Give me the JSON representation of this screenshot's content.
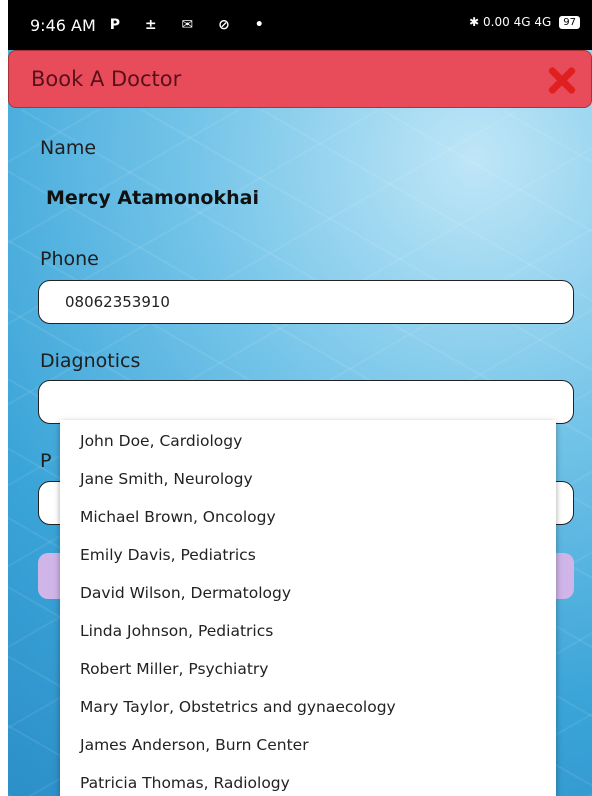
{
  "status_bar": {
    "time": "9:46 AM",
    "left_icons": "P ± ✉ ⊘ •",
    "right_icons": "✱ 0.00 4G 4G",
    "battery": "97"
  },
  "header": {
    "title": "Book A Doctor",
    "close_icon": "close-x-icon",
    "accent": "#e84c5a"
  },
  "form": {
    "name_label": "Name",
    "name_value": "Mercy Atamonokhai",
    "phone_label": "Phone",
    "phone_value": "08062353910",
    "diagnotics_label": "Diagnotics",
    "diagnotics_value": "",
    "partial_label": "P"
  },
  "dropdown": {
    "options": [
      "John Doe, Cardiology",
      "Jane Smith, Neurology",
      "Michael Brown, Oncology",
      "Emily Davis, Pediatrics",
      "David Wilson, Dermatology",
      "Linda Johnson, Pediatrics",
      "Robert Miller, Psychiatry",
      "Mary Taylor, Obstetrics and gynaecology",
      "James Anderson, Burn Center",
      "Patricia Thomas, Radiology"
    ]
  }
}
